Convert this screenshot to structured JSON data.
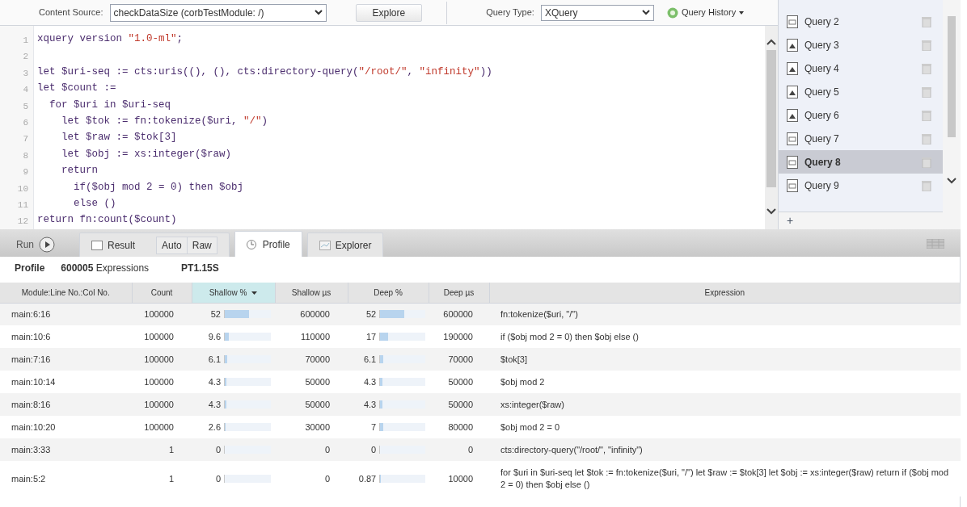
{
  "toolbar": {
    "content_source_label": "Content Source:",
    "content_source": "checkDataSize (corbTestModule: /)",
    "explore_button": "Explore",
    "query_type_label": "Query Type:",
    "query_type": "XQuery",
    "history_button": "Query History"
  },
  "editor": {
    "lines": [
      {
        "number": "1",
        "segments": [
          {
            "kind": "code",
            "t": "xquery version "
          },
          {
            "kind": "string",
            "t": "\"1.0-ml\""
          },
          {
            "kind": "code",
            "t": ";"
          }
        ]
      },
      {
        "number": "2"
      },
      {
        "number": "3",
        "segments": [
          {
            "kind": "code",
            "t": "let $uri-seq := cts:uris((), (), cts:directory-query("
          },
          {
            "kind": "string",
            "t": "\"/root/\""
          },
          {
            "kind": "code",
            "t": ", "
          },
          {
            "kind": "string",
            "t": "\"infinity\""
          },
          {
            "kind": "code",
            "t": "))"
          }
        ]
      },
      {
        "number": "4",
        "segments": [
          {
            "kind": "code",
            "t": "let $count :="
          }
        ]
      },
      {
        "number": "5",
        "segments": [
          {
            "kind": "code",
            "t": "  for $uri in $uri-seq"
          }
        ]
      },
      {
        "number": "6",
        "segments": [
          {
            "kind": "code",
            "t": "    let $tok := fn:tokenize($uri, "
          },
          {
            "kind": "string",
            "t": "\"/\""
          },
          {
            "kind": "code",
            "t": ")"
          }
        ]
      },
      {
        "number": "7",
        "segments": [
          {
            "kind": "code",
            "t": "    let $raw := $tok[3]"
          }
        ]
      },
      {
        "number": "8",
        "segments": [
          {
            "kind": "code",
            "t": "    let $obj := xs:integer($raw)"
          }
        ]
      },
      {
        "number": "9",
        "segments": [
          {
            "kind": "code",
            "t": "    return"
          }
        ]
      },
      {
        "number": "10",
        "segments": [
          {
            "kind": "code",
            "t": "      if($obj mod 2 = 0) then $obj"
          }
        ]
      },
      {
        "number": "11",
        "segments": [
          {
            "kind": "code",
            "t": "      else ()"
          }
        ]
      },
      {
        "number": "12",
        "segments": [
          {
            "kind": "code",
            "t": "return fn:count($count)"
          }
        ]
      }
    ]
  },
  "history": [
    {
      "label": "Query 2",
      "kind": "code",
      "selected": false
    },
    {
      "label": "Query 3",
      "kind": "image",
      "selected": false
    },
    {
      "label": "Query 4",
      "kind": "image",
      "selected": false
    },
    {
      "label": "Query 5",
      "kind": "image",
      "selected": false
    },
    {
      "label": "Query 6",
      "kind": "image",
      "selected": false
    },
    {
      "label": "Query 7",
      "kind": "code",
      "selected": false
    },
    {
      "label": "Query 8",
      "kind": "code",
      "selected": true
    },
    {
      "label": "Query 9",
      "kind": "code",
      "selected": false
    }
  ],
  "history_add": "+",
  "run_button": "Run",
  "tabs": [
    {
      "label": "Result",
      "selected": false,
      "kind": "result"
    },
    {
      "label": "Profile",
      "selected": true,
      "kind": "profile"
    },
    {
      "label": "Explorer",
      "selected": false,
      "kind": "explorer"
    }
  ],
  "result_modes": [
    {
      "label": "Auto",
      "selected": false
    },
    {
      "label": "Raw",
      "selected": false
    }
  ],
  "profile": {
    "title": "Profile",
    "expressions": "600005",
    "expressions_label": "Expressions",
    "time": "PT1.15S"
  },
  "table": {
    "columns": [
      {
        "label": "Module:Line No.:Col No.",
        "sorted": false
      },
      {
        "label": "Count",
        "sorted": false
      },
      {
        "label": "Shallow %",
        "sorted": true
      },
      {
        "label": "Shallow µs",
        "sorted": false
      },
      {
        "label": "Deep %",
        "sorted": false
      },
      {
        "label": "Deep µs",
        "sorted": false
      },
      {
        "label": "Expression",
        "sorted": false
      }
    ],
    "rows": [
      {
        "module": "main:6:16",
        "count": "100000",
        "shallow": {
          "pct": "52",
          "level": 0.52
        },
        "shallow_us": "600000",
        "deep": {
          "pct": "52",
          "level": 0.52
        },
        "deep_us": "600000",
        "expression": "fn:tokenize($uri, \"/\")"
      },
      {
        "module": "main:10:6",
        "count": "100000",
        "shallow": {
          "pct": "9.6",
          "level": 0.096
        },
        "shallow_us": "110000",
        "deep": {
          "pct": "17",
          "level": 0.17
        },
        "deep_us": "190000",
        "expression": "if ($obj mod 2 = 0) then $obj else ()"
      },
      {
        "module": "main:7:16",
        "count": "100000",
        "shallow": {
          "pct": "6.1",
          "level": 0.061
        },
        "shallow_us": "70000",
        "deep": {
          "pct": "6.1",
          "level": 0.061
        },
        "deep_us": "70000",
        "expression": "$tok[3]"
      },
      {
        "module": "main:10:14",
        "count": "100000",
        "shallow": {
          "pct": "4.3",
          "level": 0.043
        },
        "shallow_us": "50000",
        "deep": {
          "pct": "4.3",
          "level": 0.043
        },
        "deep_us": "50000",
        "expression": "$obj mod 2"
      },
      {
        "module": "main:8:16",
        "count": "100000",
        "shallow": {
          "pct": "4.3",
          "level": 0.043
        },
        "shallow_us": "50000",
        "deep": {
          "pct": "4.3",
          "level": 0.043
        },
        "deep_us": "50000",
        "expression": "xs:integer($raw)"
      },
      {
        "module": "main:10:20",
        "count": "100000",
        "shallow": {
          "pct": "2.6",
          "level": 0.026
        },
        "shallow_us": "30000",
        "deep": {
          "pct": "7",
          "level": 0.07
        },
        "deep_us": "80000",
        "expression": "$obj mod 2 = 0"
      },
      {
        "module": "main:3:33",
        "count": "1",
        "shallow": {
          "pct": "0",
          "level": 0
        },
        "shallow_us": "0",
        "deep": {
          "pct": "0",
          "level": 0
        },
        "deep_us": "0",
        "expression": "cts:directory-query(\"/root/\", \"infinity\")"
      },
      {
        "module": "main:5:2",
        "count": "1",
        "shallow": {
          "pct": "0",
          "level": 0
        },
        "shallow_us": "0",
        "deep": {
          "pct": "0.87",
          "level": 0.0087
        },
        "deep_us": "10000",
        "expression": "for $uri in $uri-seq let $tok := fn:tokenize($uri, \"/\") let $raw := $tok[3] let $obj := xs:integer($raw) return if ($obj mod 2 = 0) then $obj else ()"
      }
    ]
  }
}
